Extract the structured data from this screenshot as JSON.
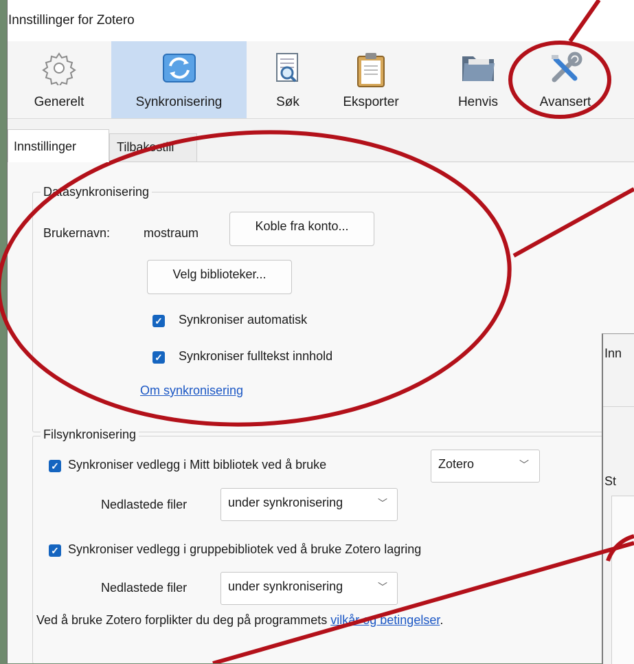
{
  "window": {
    "title": "Innstillinger for Zotero"
  },
  "toolbar": {
    "items": [
      {
        "label": "Generelt",
        "icon": "gear-icon"
      },
      {
        "label": "Synkronisering",
        "icon": "sync-icon"
      },
      {
        "label": "Søk",
        "icon": "search-doc-icon"
      },
      {
        "label": "Eksporter",
        "icon": "clipboard-icon"
      },
      {
        "label": "Henvis",
        "icon": "folder-icon"
      },
      {
        "label": "Avansert",
        "icon": "tools-icon"
      }
    ],
    "active_index": 1
  },
  "tabs": [
    "Innstillinger",
    "Tilbakestill"
  ],
  "data_sync": {
    "legend": "Datasynkronisering",
    "username_label": "Brukernavn:",
    "username_value": "mostraum",
    "unlink_button": "Koble fra konto...",
    "choose_libraries_button": "Velg biblioteker...",
    "auto_sync_label": "Synkroniser automatisk",
    "fulltext_sync_label": "Synkroniser fulltekst innhold",
    "about_link": "Om synkronisering"
  },
  "file_sync": {
    "legend": "Filsynkronisering",
    "my_library_label": "Synkroniser vedlegg i Mitt bibliotek ved å bruke",
    "my_library_method": "Zotero",
    "downloaded_label": "Nedlastede filer",
    "downloaded_value_1": "under synkronisering",
    "group_label": "Synkroniser vedlegg i gruppebibliotek ved å bruke Zotero lagring",
    "downloaded_value_2": "under synkronisering"
  },
  "terms": {
    "prefix": "Ved å bruke Zotero forplikter du deg på programmets",
    "link": "vilkår og betingelser",
    "suffix": "."
  },
  "second_window": {
    "title_fragment": "Inn",
    "tab_fragment": "St"
  },
  "annotation_color": "#b3111a"
}
